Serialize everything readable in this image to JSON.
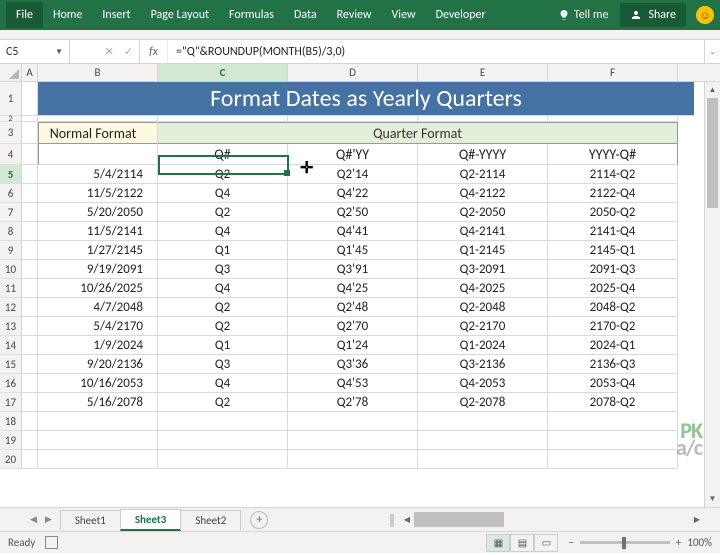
{
  "ribbon": {
    "tabs": [
      "File",
      "Home",
      "Insert",
      "Page Layout",
      "Formulas",
      "Data",
      "Review",
      "View",
      "Developer"
    ],
    "tell_me": "Tell me",
    "share": "Share"
  },
  "namebox": {
    "value": "C5"
  },
  "formula": {
    "value": "=\"Q\"&ROUNDUP(MONTH(B5)/3,0)"
  },
  "columns": [
    "A",
    "B",
    "C",
    "D",
    "E",
    "F"
  ],
  "title": "Format Dates as Yearly Quarters",
  "headers": {
    "normal": "Normal Format",
    "quarter": "Quarter Format",
    "sub": {
      "C": "Q#",
      "D": "Q#'YY",
      "E": "Q#-YYYY",
      "F": "YYYY-Q#"
    }
  },
  "rows": [
    {
      "n": 5,
      "b": "5/4/2114",
      "c": "Q2",
      "d": "Q2'14",
      "e": "Q2-2114",
      "f": "2114-Q2"
    },
    {
      "n": 6,
      "b": "11/5/2122",
      "c": "Q4",
      "d": "Q4'22",
      "e": "Q4-2122",
      "f": "2122-Q4"
    },
    {
      "n": 7,
      "b": "5/20/2050",
      "c": "Q2",
      "d": "Q2'50",
      "e": "Q2-2050",
      "f": "2050-Q2"
    },
    {
      "n": 8,
      "b": "11/5/2141",
      "c": "Q4",
      "d": "Q4'41",
      "e": "Q4-2141",
      "f": "2141-Q4"
    },
    {
      "n": 9,
      "b": "1/27/2145",
      "c": "Q1",
      "d": "Q1'45",
      "e": "Q1-2145",
      "f": "2145-Q1"
    },
    {
      "n": 10,
      "b": "9/19/2091",
      "c": "Q3",
      "d": "Q3'91",
      "e": "Q3-2091",
      "f": "2091-Q3"
    },
    {
      "n": 11,
      "b": "10/26/2025",
      "c": "Q4",
      "d": "Q4'25",
      "e": "Q4-2025",
      "f": "2025-Q4"
    },
    {
      "n": 12,
      "b": "4/7/2048",
      "c": "Q2",
      "d": "Q2'48",
      "e": "Q2-2048",
      "f": "2048-Q2"
    },
    {
      "n": 13,
      "b": "5/4/2170",
      "c": "Q2",
      "d": "Q2'70",
      "e": "Q2-2170",
      "f": "2170-Q2"
    },
    {
      "n": 14,
      "b": "1/9/2024",
      "c": "Q1",
      "d": "Q1'24",
      "e": "Q1-2024",
      "f": "2024-Q1"
    },
    {
      "n": 15,
      "b": "9/20/2136",
      "c": "Q3",
      "d": "Q3'36",
      "e": "Q3-2136",
      "f": "2136-Q3"
    },
    {
      "n": 16,
      "b": "10/16/2053",
      "c": "Q4",
      "d": "Q4'53",
      "e": "Q4-2053",
      "f": "2053-Q4"
    },
    {
      "n": 17,
      "b": "5/16/2078",
      "c": "Q2",
      "d": "Q2'78",
      "e": "Q2-2078",
      "f": "2078-Q2"
    }
  ],
  "blank_rows": [
    18,
    19,
    20
  ],
  "sheets": {
    "items": [
      "Sheet1",
      "Sheet3",
      "Sheet2"
    ],
    "active": "Sheet3"
  },
  "status": {
    "label": "Ready",
    "zoom": "100%"
  },
  "watermark": {
    "line1": "PK",
    "line2": "a/c"
  }
}
